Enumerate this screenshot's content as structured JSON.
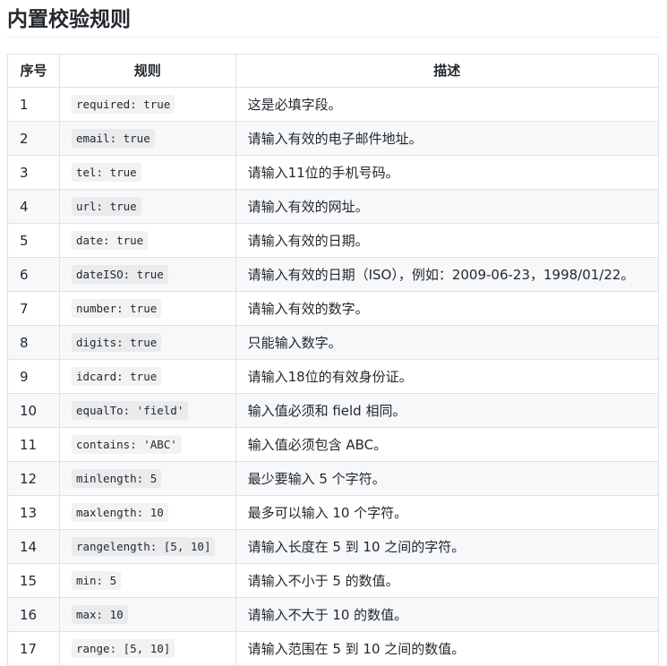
{
  "title": "内置校验规则",
  "columns": [
    "序号",
    "规则",
    "描述"
  ],
  "rows": [
    {
      "no": "1",
      "rule": "required: true",
      "desc": "这是必填字段。"
    },
    {
      "no": "2",
      "rule": "email: true",
      "desc": "请输入有效的电子邮件地址。"
    },
    {
      "no": "3",
      "rule": "tel: true",
      "desc": "请输入11位的手机号码。"
    },
    {
      "no": "4",
      "rule": "url: true",
      "desc": "请输入有效的网址。"
    },
    {
      "no": "5",
      "rule": "date: true",
      "desc": "请输入有效的日期。"
    },
    {
      "no": "6",
      "rule": "dateISO: true",
      "desc": "请输入有效的日期（ISO），例如：2009-06-23，1998/01/22。"
    },
    {
      "no": "7",
      "rule": "number: true",
      "desc": "请输入有效的数字。"
    },
    {
      "no": "8",
      "rule": "digits: true",
      "desc": "只能输入数字。"
    },
    {
      "no": "9",
      "rule": "idcard: true",
      "desc": "请输入18位的有效身份证。"
    },
    {
      "no": "10",
      "rule": "equalTo: 'field'",
      "desc": "输入值必须和 field 相同。"
    },
    {
      "no": "11",
      "rule": "contains: 'ABC'",
      "desc": "输入值必须包含 ABC。"
    },
    {
      "no": "12",
      "rule": "minlength: 5",
      "desc": "最少要输入 5 个字符。"
    },
    {
      "no": "13",
      "rule": "maxlength: 10",
      "desc": "最多可以输入 10 个字符。"
    },
    {
      "no": "14",
      "rule": "rangelength: [5, 10]",
      "desc": "请输入长度在 5 到 10 之间的字符。"
    },
    {
      "no": "15",
      "rule": "min: 5",
      "desc": "请输入不小于 5 的数值。"
    },
    {
      "no": "16",
      "rule": "max: 10",
      "desc": "请输入不大于 10 的数值。"
    },
    {
      "no": "17",
      "rule": "range: [5, 10]",
      "desc": "请输入范围在 5 到 10 之间的数值。"
    }
  ]
}
